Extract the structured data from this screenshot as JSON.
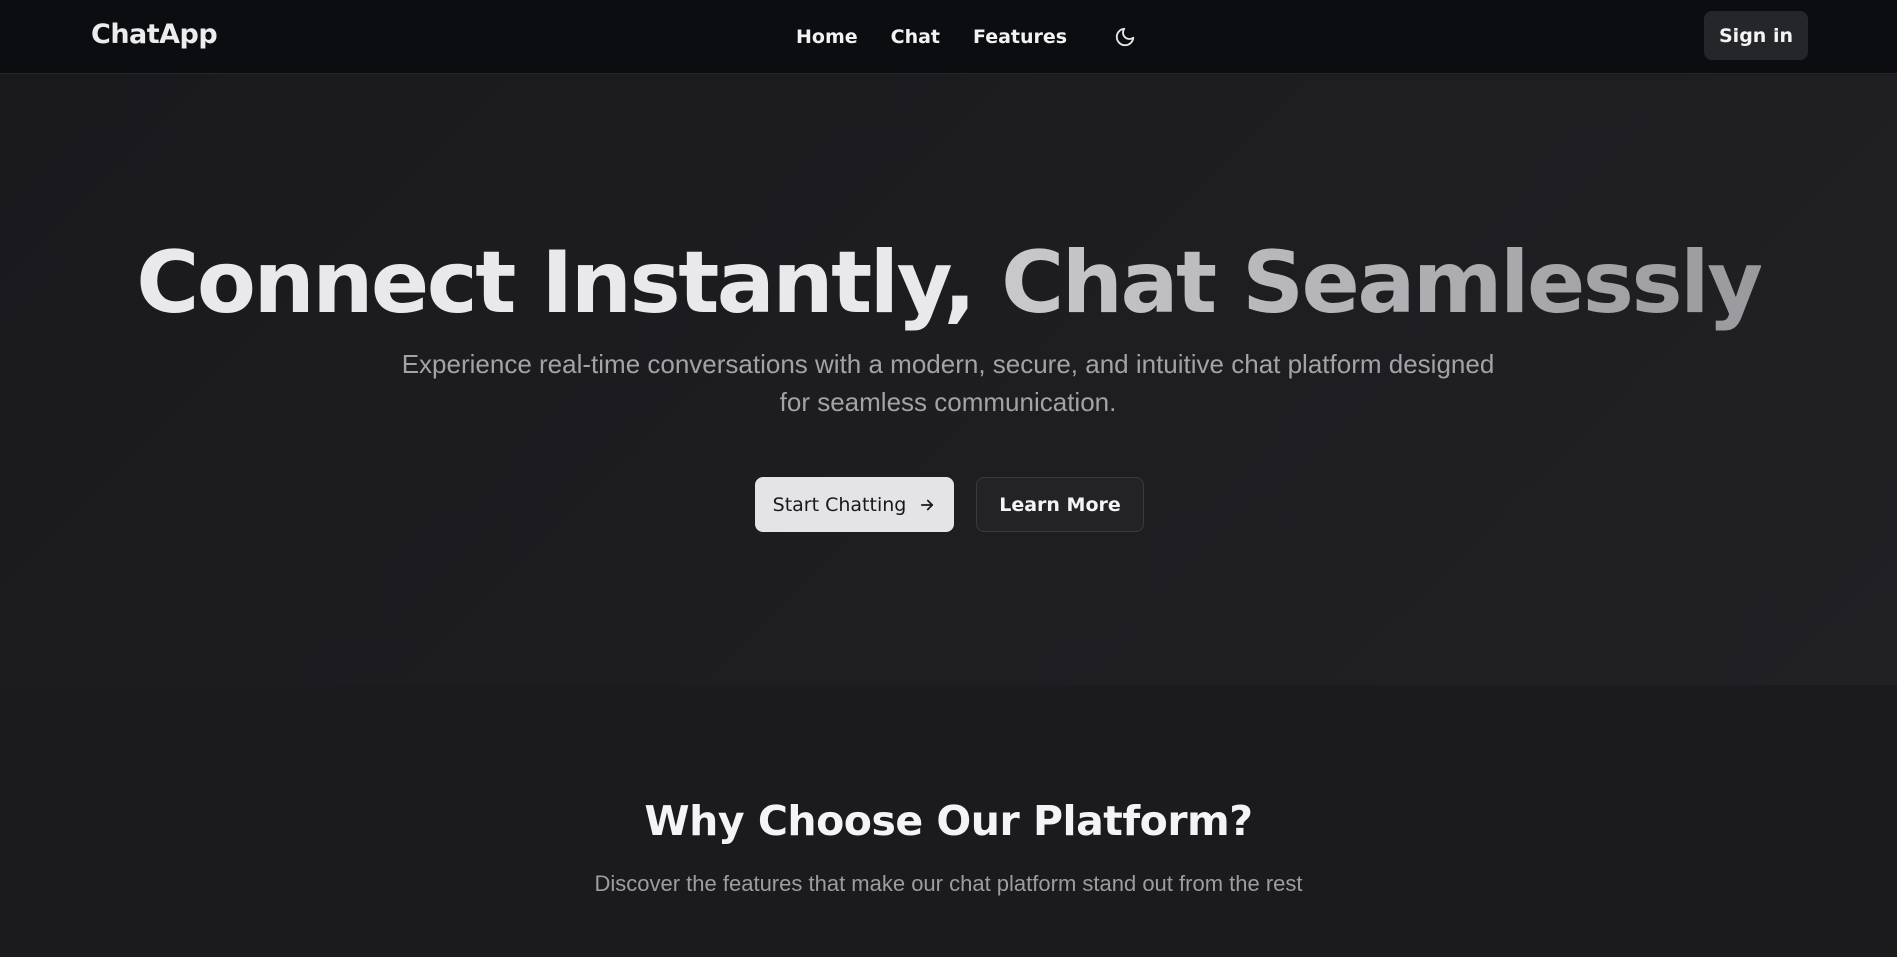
{
  "navbar": {
    "brand": "ChatApp",
    "links": [
      {
        "label": "Home"
      },
      {
        "label": "Chat"
      },
      {
        "label": "Features"
      }
    ],
    "theme_toggle_icon": "moon-icon",
    "sign_in_label": "Sign in"
  },
  "hero": {
    "title_part1": "Connect Instantly, ",
    "title_part2": "Chat Seamlessly",
    "subtitle": "Experience real-time conversations with a modern, secure, and intuitive chat platform designed for seamless communication.",
    "primary_button": "Start Chatting",
    "primary_button_icon": "arrow-right-icon",
    "secondary_button": "Learn More"
  },
  "features": {
    "title": "Why Choose Our Platform?",
    "subtitle": "Discover the features that make our chat platform stand out from the rest"
  },
  "colors": {
    "navbar_bg": "#0c0d10",
    "page_bg": "#1c1c1f",
    "primary_button_bg": "#e4e4e7",
    "secondary_button_bg": "#232326"
  }
}
